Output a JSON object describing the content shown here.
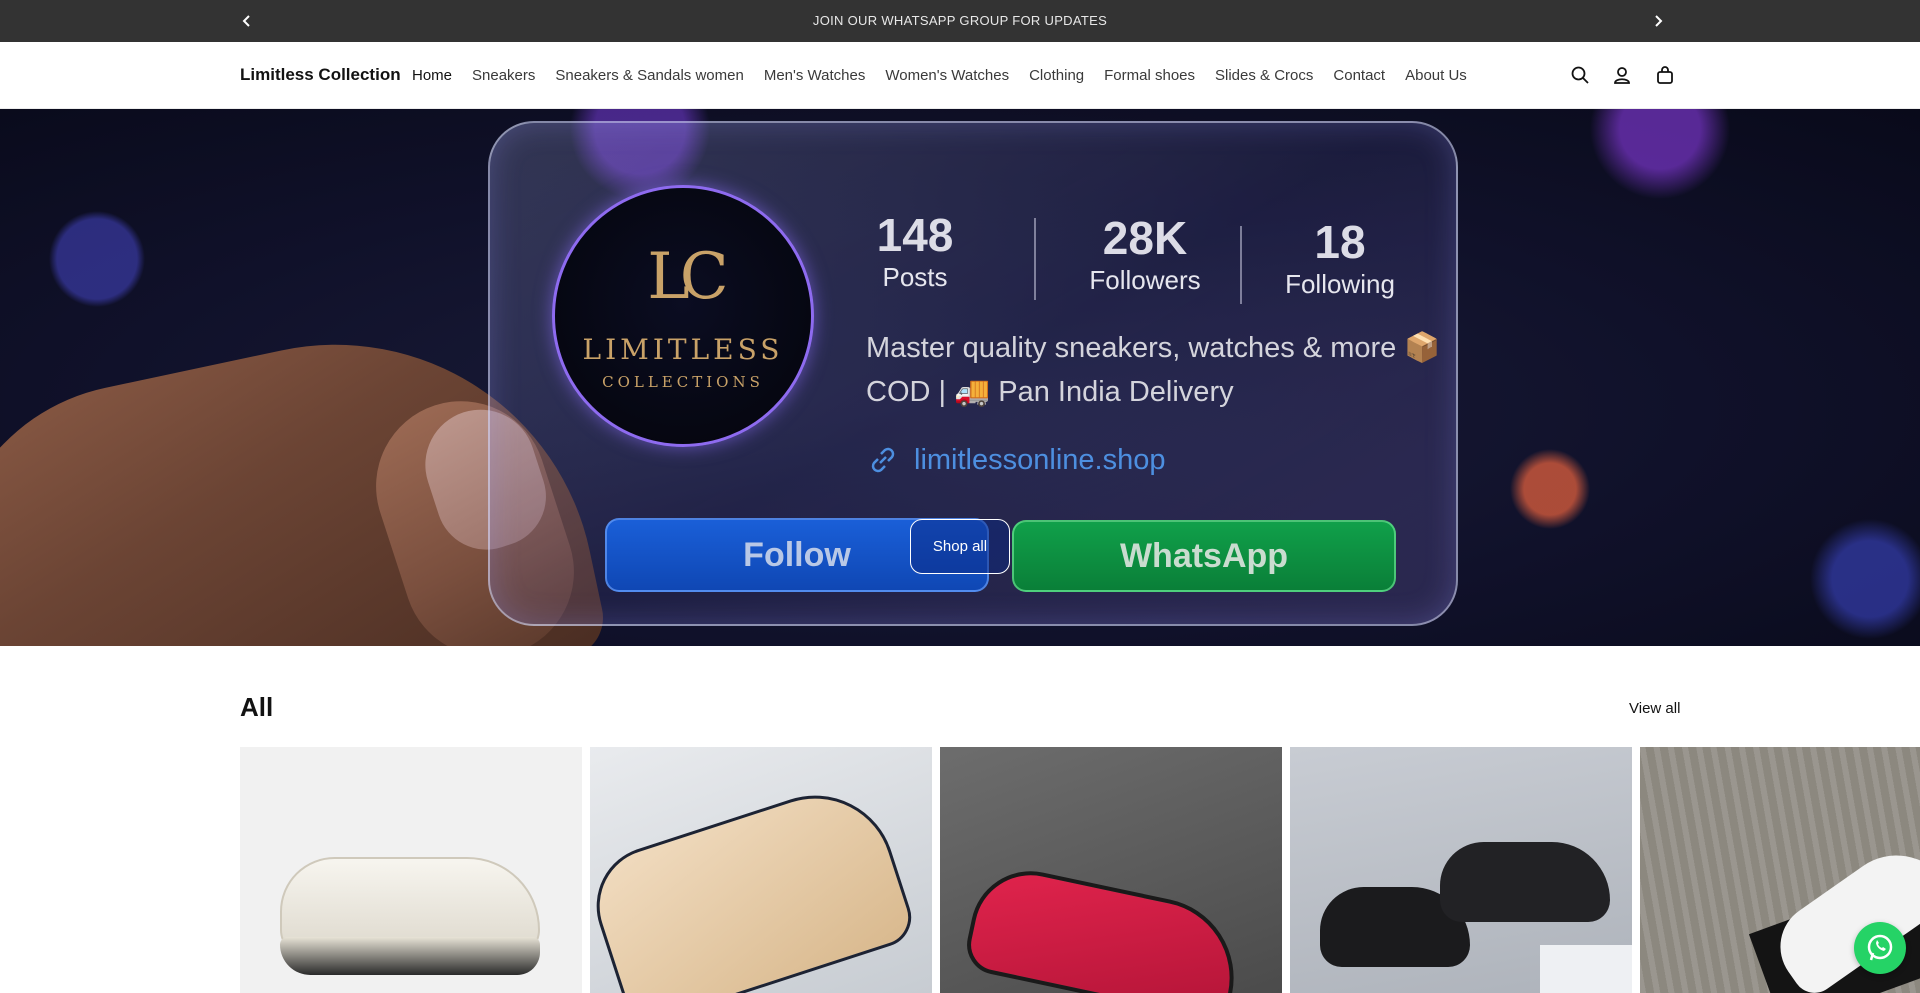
{
  "announcement": {
    "text": "JOIN OUR WHATSAPP GROUP FOR UPDATES",
    "prev_icon": "chevron-left-icon",
    "next_icon": "chevron-right-icon"
  },
  "header": {
    "brand": "Limitless Collection",
    "nav": [
      {
        "label": "Home"
      },
      {
        "label": "Sneakers"
      },
      {
        "label": "Sneakers & Sandals women"
      },
      {
        "label": "Men's Watches"
      },
      {
        "label": "Women's Watches"
      },
      {
        "label": "Clothing"
      },
      {
        "label": "Formal shoes"
      },
      {
        "label": "Slides & Crocs"
      },
      {
        "label": "Contact"
      },
      {
        "label": "About Us"
      }
    ],
    "icons": [
      "search-icon",
      "account-icon",
      "cart-icon"
    ]
  },
  "hero": {
    "logo_monogram": "LC",
    "logo_word": "LIMITLESS",
    "logo_sub": "COLLECTIONS",
    "stats": [
      {
        "number": "148",
        "label": "Posts"
      },
      {
        "number": "28K",
        "label": "Followers"
      },
      {
        "number": "18",
        "label": "Following"
      }
    ],
    "bio_line1": "Master quality sneakers, watches & more 📦",
    "bio_line2": "COD  |  🚚  Pan India Delivery",
    "link": "limitlessonline.shop",
    "follow_label": "Follow",
    "whatsapp_label": "WhatsApp",
    "shop_all_label": "Shop all"
  },
  "collection": {
    "title": "All",
    "view_all_label": "View all"
  },
  "colors": {
    "announce_bg": "#333333",
    "whatsapp_green": "#25d366"
  }
}
